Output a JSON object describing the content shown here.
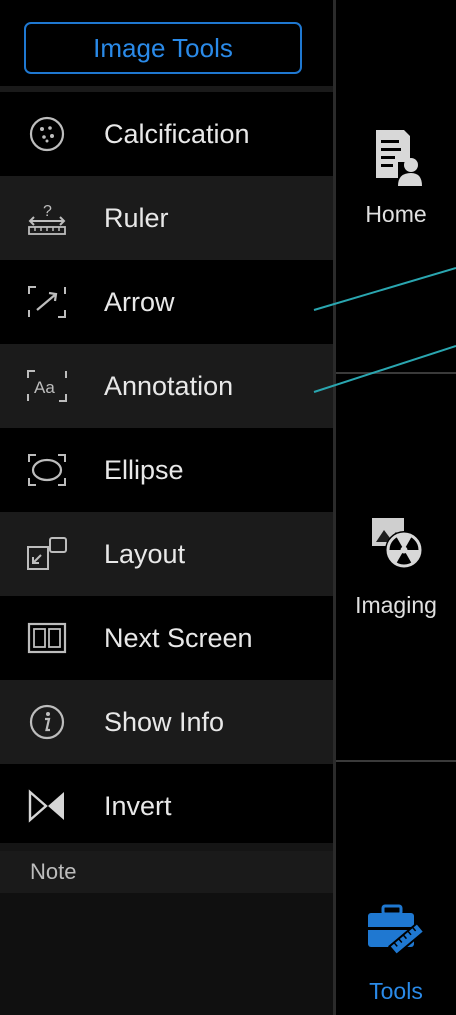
{
  "panel": {
    "title": "Image Tools",
    "tools": [
      {
        "label": "Calcification",
        "icon": "calcification-icon"
      },
      {
        "label": "Ruler",
        "icon": "ruler-icon"
      },
      {
        "label": "Arrow",
        "icon": "arrow-icon"
      },
      {
        "label": "Annotation",
        "icon": "annotation-icon"
      },
      {
        "label": "Ellipse",
        "icon": "ellipse-icon"
      },
      {
        "label": "Layout",
        "icon": "layout-icon"
      },
      {
        "label": "Next Screen",
        "icon": "next-screen-icon"
      },
      {
        "label": "Show Info",
        "icon": "info-icon"
      },
      {
        "label": "Invert",
        "icon": "invert-icon"
      }
    ],
    "note_label": "Note"
  },
  "nav": {
    "home": {
      "label": "Home",
      "icon": "home-document-icon"
    },
    "imaging": {
      "label": "Imaging",
      "icon": "imaging-radiation-icon"
    },
    "tools": {
      "label": "Tools",
      "icon": "toolbox-icon",
      "active": true
    }
  },
  "colors": {
    "accent": "#1f78d1",
    "callout_line": "#2aa6b0"
  }
}
